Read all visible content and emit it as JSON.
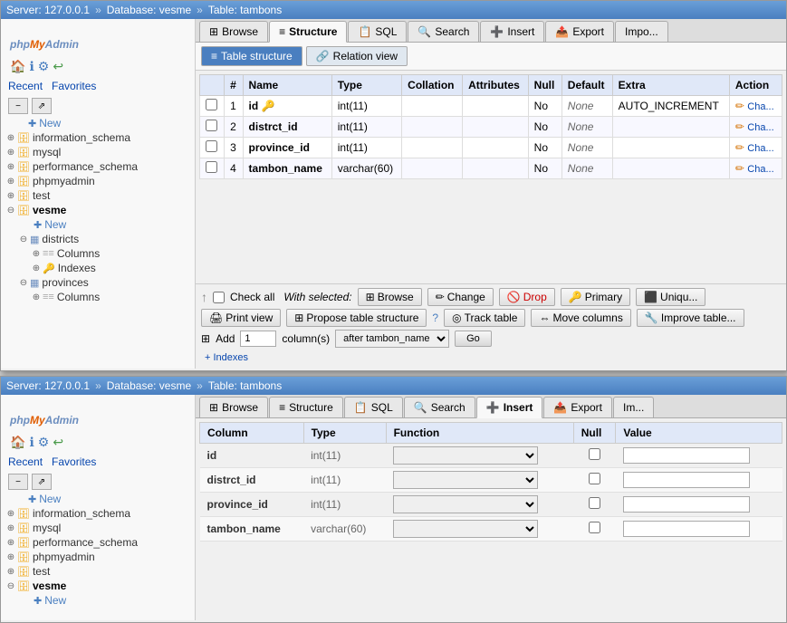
{
  "top_window": {
    "titlebar": {
      "server": "Server: 127.0.0.1",
      "sep1": "»",
      "database": "Database: vesme",
      "sep2": "»",
      "table": "Table: tambons"
    },
    "tabs": [
      {
        "id": "browse",
        "label": "Browse",
        "icon": "⊞"
      },
      {
        "id": "structure",
        "label": "Structure",
        "icon": "≡",
        "active": true
      },
      {
        "id": "sql",
        "label": "SQL",
        "icon": "📋"
      },
      {
        "id": "search",
        "label": "Search",
        "icon": "🔍"
      },
      {
        "id": "insert",
        "label": "Insert",
        "icon": "➕"
      },
      {
        "id": "export",
        "label": "Export",
        "icon": "📤"
      },
      {
        "id": "import",
        "label": "Impo..."
      }
    ],
    "sub_tabs": [
      {
        "id": "table-structure",
        "label": "Table structure",
        "icon": "≡",
        "active": true
      },
      {
        "id": "relation-view",
        "label": "Relation view",
        "icon": "🔗"
      }
    ],
    "table_headers": [
      "#",
      "Name",
      "Type",
      "Collation",
      "Attributes",
      "Null",
      "Default",
      "Extra",
      "Action"
    ],
    "rows": [
      {
        "num": "1",
        "name": "id",
        "has_key": true,
        "type": "int(11)",
        "collation": "",
        "attributes": "",
        "null": "No",
        "default": "None",
        "extra": "AUTO_INCREMENT",
        "action": "Cha..."
      },
      {
        "num": "2",
        "name": "distrct_id",
        "has_key": false,
        "type": "int(11)",
        "collation": "",
        "attributes": "",
        "null": "No",
        "default": "None",
        "extra": "",
        "action": "Cha..."
      },
      {
        "num": "3",
        "name": "province_id",
        "has_key": false,
        "type": "int(11)",
        "collation": "",
        "attributes": "",
        "null": "No",
        "default": "None",
        "extra": "",
        "action": "Cha..."
      },
      {
        "num": "4",
        "name": "tambon_name",
        "has_key": false,
        "type": "varchar(60)",
        "collation": "",
        "attributes": "",
        "null": "No",
        "default": "None",
        "extra": "",
        "action": "Cha..."
      }
    ],
    "footer": {
      "check_all": "Check all",
      "with_selected": "With selected:",
      "browse_btn": "Browse",
      "change_btn": "Change",
      "drop_btn": "Drop",
      "primary_btn": "Primary",
      "unique_btn": "Uniqu...",
      "print_view": "Print view",
      "propose_structure": "Propose table structure",
      "track_table": "Track table",
      "move_columns": "Move columns",
      "improve_table": "Improve table...",
      "add_label": "Add",
      "add_num": "1",
      "columns_label": "column(s)",
      "after_label": "after tambon_name",
      "go_btn": "Go",
      "indexes_link": "+ Indexes"
    },
    "sidebar": {
      "logo_php": "php",
      "logo_my": "My",
      "logo_admin": "Admin",
      "recent": "Recent",
      "favorites": "Favorites",
      "items": [
        {
          "id": "new-top",
          "label": "New",
          "type": "new",
          "indent": 0
        },
        {
          "id": "information_schema",
          "label": "information_schema",
          "type": "db",
          "indent": 0
        },
        {
          "id": "mysql",
          "label": "mysql",
          "type": "db",
          "indent": 0
        },
        {
          "id": "performance_schema",
          "label": "performance_schema",
          "type": "db",
          "indent": 0
        },
        {
          "id": "phpmyadmin",
          "label": "phpmyadmin",
          "type": "db",
          "indent": 0
        },
        {
          "id": "test",
          "label": "test",
          "type": "db",
          "indent": 0
        },
        {
          "id": "vesme",
          "label": "vesme",
          "type": "db",
          "open": true,
          "indent": 0
        },
        {
          "id": "vesme-new",
          "label": "New",
          "type": "new",
          "indent": 1
        },
        {
          "id": "districts",
          "label": "districts",
          "type": "table",
          "open": true,
          "indent": 1
        },
        {
          "id": "districts-columns",
          "label": "Columns",
          "type": "columns",
          "indent": 2
        },
        {
          "id": "districts-indexes",
          "label": "Indexes",
          "type": "indexes",
          "indent": 2
        },
        {
          "id": "provinces",
          "label": "provinces",
          "type": "table",
          "open": true,
          "indent": 1
        },
        {
          "id": "provinces-columns",
          "label": "Columns",
          "type": "columns",
          "indent": 2
        }
      ]
    }
  },
  "bottom_window": {
    "titlebar": {
      "server": "Server: 127.0.0.1",
      "sep1": "»",
      "database": "Database: vesme",
      "sep2": "»",
      "table": "Table: tambons"
    },
    "tabs": [
      {
        "id": "browse",
        "label": "Browse",
        "icon": "⊞"
      },
      {
        "id": "structure",
        "label": "Structure",
        "icon": "≡"
      },
      {
        "id": "sql",
        "label": "SQL",
        "icon": "📋"
      },
      {
        "id": "search",
        "label": "Search",
        "icon": "🔍"
      },
      {
        "id": "insert",
        "label": "Insert",
        "icon": "➕",
        "active": true
      },
      {
        "id": "export",
        "label": "Export",
        "icon": "📤"
      },
      {
        "id": "import",
        "label": "Im..."
      }
    ],
    "insert_headers": [
      "Column",
      "Type",
      "Function",
      "Null",
      "Value"
    ],
    "insert_rows": [
      {
        "column": "id",
        "type": "int(11)"
      },
      {
        "column": "distrct_id",
        "type": "int(11)"
      },
      {
        "column": "province_id",
        "type": "int(11)"
      },
      {
        "column": "tambon_name",
        "type": "varchar(60)"
      }
    ],
    "sidebar": {
      "logo_php": "php",
      "logo_my": "My",
      "logo_admin": "Admin",
      "recent": "Recent",
      "favorites": "Favorites",
      "items": [
        {
          "id": "new-top2",
          "label": "New",
          "type": "new",
          "indent": 0
        },
        {
          "id": "information_schema2",
          "label": "information_schema",
          "type": "db",
          "indent": 0
        },
        {
          "id": "mysql2",
          "label": "mysql",
          "type": "db",
          "indent": 0
        },
        {
          "id": "performance_schema2",
          "label": "performance_schema",
          "type": "db",
          "indent": 0
        },
        {
          "id": "phpmyadmin2",
          "label": "phpmyadmin",
          "type": "db",
          "indent": 0
        },
        {
          "id": "test2",
          "label": "test",
          "type": "db",
          "indent": 0
        },
        {
          "id": "vesme2",
          "label": "vesme",
          "type": "db",
          "open": true,
          "indent": 0
        },
        {
          "id": "vesme-new2",
          "label": "New",
          "type": "new",
          "indent": 1
        }
      ]
    }
  },
  "colors": {
    "accent": "#4a7fc0",
    "brand_orange": "#e05c00",
    "link": "#0645ad"
  }
}
